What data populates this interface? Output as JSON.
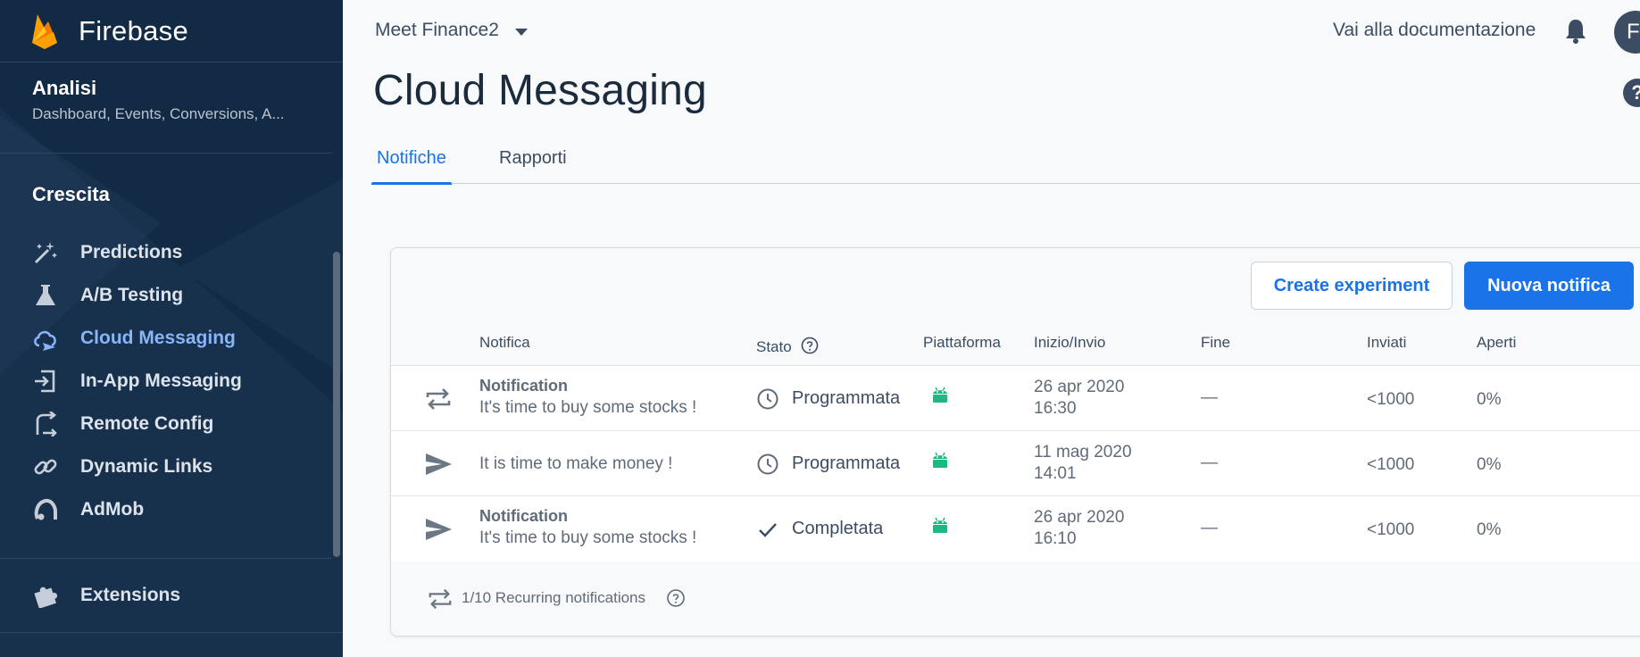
{
  "sidebar": {
    "brand": "Firebase",
    "analytics": {
      "title": "Analisi",
      "subtitle": "Dashboard, Events, Conversions, A..."
    },
    "section_title": "Crescita",
    "items": [
      {
        "label": "Predictions",
        "icon": "magic-wand-icon"
      },
      {
        "label": "A/B Testing",
        "icon": "flask-icon"
      },
      {
        "label": "Cloud Messaging",
        "icon": "cloud-messaging-icon",
        "active": true
      },
      {
        "label": "In-App Messaging",
        "icon": "in-app-messaging-icon"
      },
      {
        "label": "Remote Config",
        "icon": "remote-config-icon"
      },
      {
        "label": "Dynamic Links",
        "icon": "link-icon"
      },
      {
        "label": "AdMob",
        "icon": "admob-icon"
      }
    ],
    "extensions": {
      "label": "Extensions",
      "icon": "puzzle-icon"
    }
  },
  "header": {
    "project": "Meet Finance2",
    "docs_link": "Vai alla documentazione",
    "avatar_initial": "F",
    "help": "?"
  },
  "page": {
    "title": "Cloud Messaging",
    "tabs": [
      {
        "label": "Notifiche",
        "active": true
      },
      {
        "label": "Rapporti",
        "active": false
      }
    ]
  },
  "toolbar": {
    "create_experiment": "Create experiment",
    "new_notification": "Nuova notifica"
  },
  "table": {
    "columns": [
      "Notifica",
      "Stato",
      "Piattaforma",
      "Inizio/Invio",
      "Fine",
      "Inviati",
      "Aperti"
    ],
    "rows": [
      {
        "type": "recurring",
        "title": "Notification",
        "body": "It's time to buy some stocks !",
        "status": "Programmata",
        "status_icon": "clock-icon",
        "platform": "android-icon",
        "date": "26 apr 2020",
        "time": "16:30",
        "end": "—",
        "sent": "<1000",
        "opened": "0%"
      },
      {
        "type": "send",
        "title": "",
        "body": "It is time to make money !",
        "status": "Programmata",
        "status_icon": "clock-icon",
        "platform": "android-icon",
        "date": "11 mag 2020",
        "time": "14:01",
        "end": "—",
        "sent": "<1000",
        "opened": "0%"
      },
      {
        "type": "send",
        "title": "Notification",
        "body": "It's time to buy some stocks !",
        "status": "Completata",
        "status_icon": "check-icon",
        "platform": "android-icon",
        "date": "26 apr 2020",
        "time": "16:10",
        "end": "—",
        "sent": "<1000",
        "opened": "0%"
      }
    ]
  },
  "footer": {
    "recurring": "1/10 Recurring notifications"
  },
  "colors": {
    "sidebar_bg": "#132a44",
    "accent": "#1a73e8",
    "active_nav": "#8ab4f8",
    "android": "#1eb980"
  }
}
